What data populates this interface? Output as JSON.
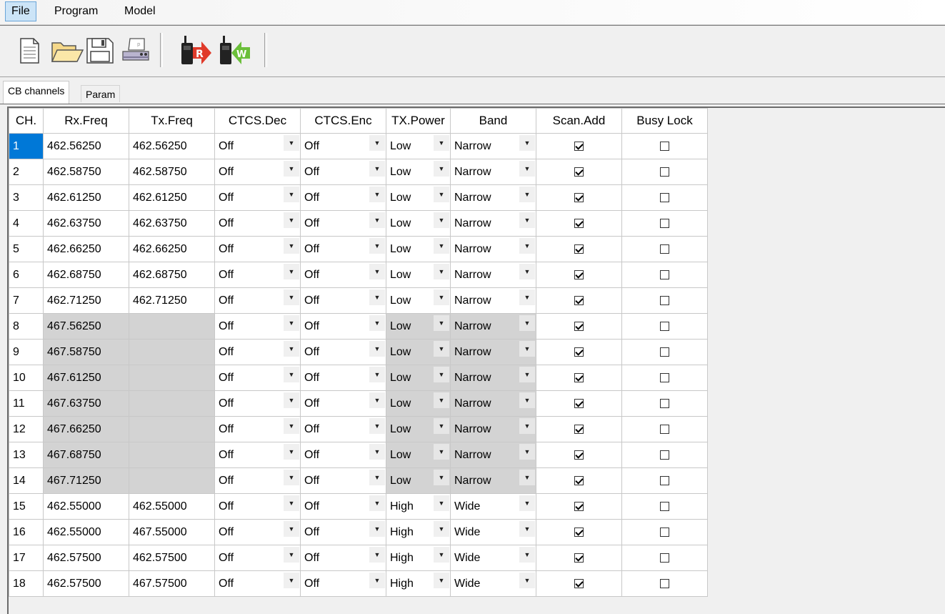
{
  "menu": {
    "items": [
      {
        "label": "File",
        "active": true
      },
      {
        "label": "Program",
        "active": false
      },
      {
        "label": "Model",
        "active": false
      }
    ]
  },
  "toolbar": {
    "buttons": [
      {
        "name": "new-document-icon"
      },
      {
        "name": "open-folder-icon"
      },
      {
        "name": "save-floppy-icon"
      },
      {
        "name": "print-icon"
      },
      {
        "name": "read-from-radio-icon",
        "badge": "R",
        "badge_color": "#e03a2a"
      },
      {
        "name": "write-to-radio-icon",
        "badge": "W",
        "badge_color": "#6bbf3a"
      }
    ]
  },
  "tabs": [
    {
      "label": "CB channels",
      "active": true
    },
    {
      "label": "Param",
      "active": false
    }
  ],
  "grid": {
    "columns": [
      "CH.",
      "Rx.Freq",
      "Tx.Freq",
      "CTCS.Dec",
      "CTCS.Enc",
      "TX.Power",
      "Band",
      "Scan.Add",
      "Busy Lock"
    ],
    "selected_channel": "1",
    "rows": [
      {
        "ch": "1",
        "rx": "462.56250",
        "tx": "462.56250",
        "dec": "Off",
        "enc": "Off",
        "power": "Low",
        "band": "Narrow",
        "scan": true,
        "busy": false,
        "locked": false
      },
      {
        "ch": "2",
        "rx": "462.58750",
        "tx": "462.58750",
        "dec": "Off",
        "enc": "Off",
        "power": "Low",
        "band": "Narrow",
        "scan": true,
        "busy": false,
        "locked": false
      },
      {
        "ch": "3",
        "rx": "462.61250",
        "tx": "462.61250",
        "dec": "Off",
        "enc": "Off",
        "power": "Low",
        "band": "Narrow",
        "scan": true,
        "busy": false,
        "locked": false
      },
      {
        "ch": "4",
        "rx": "462.63750",
        "tx": "462.63750",
        "dec": "Off",
        "enc": "Off",
        "power": "Low",
        "band": "Narrow",
        "scan": true,
        "busy": false,
        "locked": false
      },
      {
        "ch": "5",
        "rx": "462.66250",
        "tx": "462.66250",
        "dec": "Off",
        "enc": "Off",
        "power": "Low",
        "band": "Narrow",
        "scan": true,
        "busy": false,
        "locked": false
      },
      {
        "ch": "6",
        "rx": "462.68750",
        "tx": "462.68750",
        "dec": "Off",
        "enc": "Off",
        "power": "Low",
        "band": "Narrow",
        "scan": true,
        "busy": false,
        "locked": false
      },
      {
        "ch": "7",
        "rx": "462.71250",
        "tx": "462.71250",
        "dec": "Off",
        "enc": "Off",
        "power": "Low",
        "band": "Narrow",
        "scan": true,
        "busy": false,
        "locked": false
      },
      {
        "ch": "8",
        "rx": "467.56250",
        "tx": "",
        "dec": "Off",
        "enc": "Off",
        "power": "Low",
        "band": "Narrow",
        "scan": true,
        "busy": false,
        "locked": true
      },
      {
        "ch": "9",
        "rx": "467.58750",
        "tx": "",
        "dec": "Off",
        "enc": "Off",
        "power": "Low",
        "band": "Narrow",
        "scan": true,
        "busy": false,
        "locked": true
      },
      {
        "ch": "10",
        "rx": "467.61250",
        "tx": "",
        "dec": "Off",
        "enc": "Off",
        "power": "Low",
        "band": "Narrow",
        "scan": true,
        "busy": false,
        "locked": true
      },
      {
        "ch": "11",
        "rx": "467.63750",
        "tx": "",
        "dec": "Off",
        "enc": "Off",
        "power": "Low",
        "band": "Narrow",
        "scan": true,
        "busy": false,
        "locked": true
      },
      {
        "ch": "12",
        "rx": "467.66250",
        "tx": "",
        "dec": "Off",
        "enc": "Off",
        "power": "Low",
        "band": "Narrow",
        "scan": true,
        "busy": false,
        "locked": true
      },
      {
        "ch": "13",
        "rx": "467.68750",
        "tx": "",
        "dec": "Off",
        "enc": "Off",
        "power": "Low",
        "band": "Narrow",
        "scan": true,
        "busy": false,
        "locked": true
      },
      {
        "ch": "14",
        "rx": "467.71250",
        "tx": "",
        "dec": "Off",
        "enc": "Off",
        "power": "Low",
        "band": "Narrow",
        "scan": true,
        "busy": false,
        "locked": true
      },
      {
        "ch": "15",
        "rx": "462.55000",
        "tx": "462.55000",
        "dec": "Off",
        "enc": "Off",
        "power": "High",
        "band": "Wide",
        "scan": true,
        "busy": false,
        "locked": false
      },
      {
        "ch": "16",
        "rx": "462.55000",
        "tx": "467.55000",
        "dec": "Off",
        "enc": "Off",
        "power": "High",
        "band": "Wide",
        "scan": true,
        "busy": false,
        "locked": false
      },
      {
        "ch": "17",
        "rx": "462.57500",
        "tx": "462.57500",
        "dec": "Off",
        "enc": "Off",
        "power": "High",
        "band": "Wide",
        "scan": true,
        "busy": false,
        "locked": false
      },
      {
        "ch": "18",
        "rx": "462.57500",
        "tx": "467.57500",
        "dec": "Off",
        "enc": "Off",
        "power": "High",
        "band": "Wide",
        "scan": true,
        "busy": false,
        "locked": false
      }
    ]
  }
}
